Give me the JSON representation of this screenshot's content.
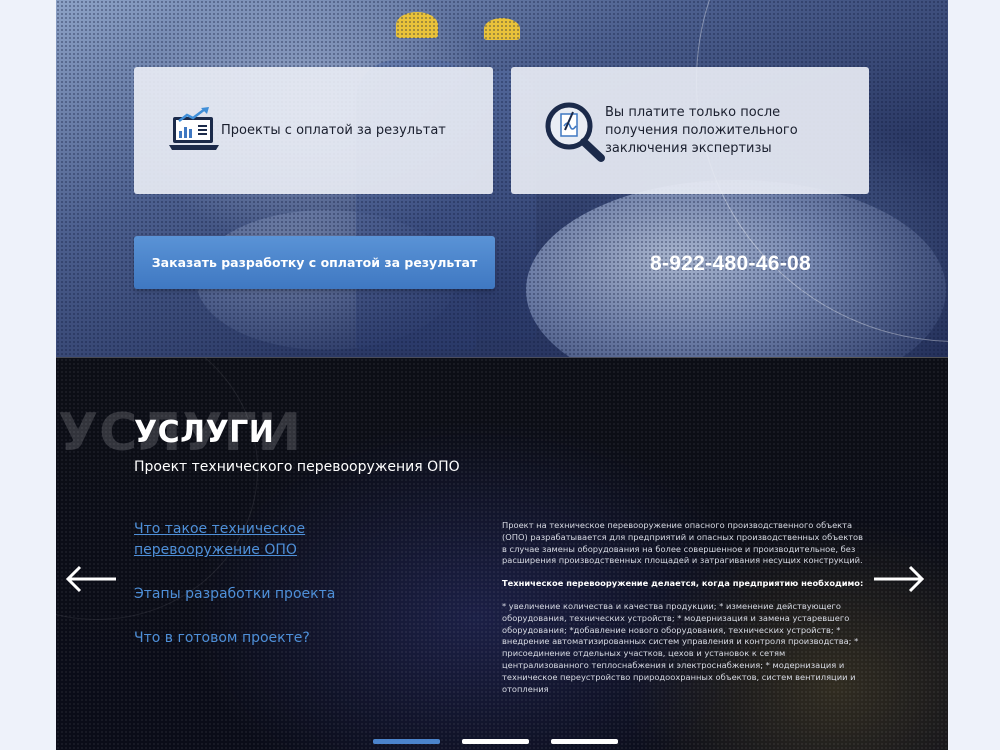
{
  "hero": {
    "card1_text": "Проекты с оплатой за результат",
    "card2_text": "Вы платите только после получения положительного заключения экспертизы",
    "cta_label": "Заказать разработку с оплатой за результат",
    "phone": "8-922-480-46-08"
  },
  "services": {
    "ghost_text": "УСЛУГИ",
    "title": "УСЛУГИ",
    "subtitle": "Проект технического перевооружения ОПО",
    "nav": [
      {
        "label": "Что такое техническое перевооружение ОПО",
        "active": true
      },
      {
        "label": "Этапы разработки проекта",
        "active": false
      },
      {
        "label": "Что в готовом проекте?",
        "active": false
      }
    ],
    "body": {
      "intro": "Проект на техническое перевооружение опасного производственного объекта (ОПО) разрабатывается для предприятий и опасных производственных объектов в случае замены оборудования на более совершенное и производительное, без расширения производственных площадей и затрагивания несущих конструкций.",
      "heading": "Техническое перевооружение делается, когда предприятию необходимо:",
      "list": "* увеличение количества и качества продукции; * изменение действующего оборудования, технических устройств; * модернизация и замена устаревшего оборудования; *добавление нового оборудования, технических устройств; * внедрение автоматизированных систем управления и контроля производства; * присоединение отдельных участков, цехов и установок к сетям централизованного теплоснабжения и электроснабжения; * модернизация и техническое переустройство природоохранных объектов, систем вентиляции и отопления"
    },
    "slider": {
      "slides": 3,
      "active_index": 0
    }
  },
  "icons": [
    "laptop-chart-icon",
    "magnifier-document-icon",
    "arrow-left-icon",
    "arrow-right-icon"
  ],
  "colors": {
    "accent": "#4b84cc",
    "link": "#4e8fd8",
    "cta": "#4a86cc",
    "dark_bg": "#0b0d17"
  }
}
